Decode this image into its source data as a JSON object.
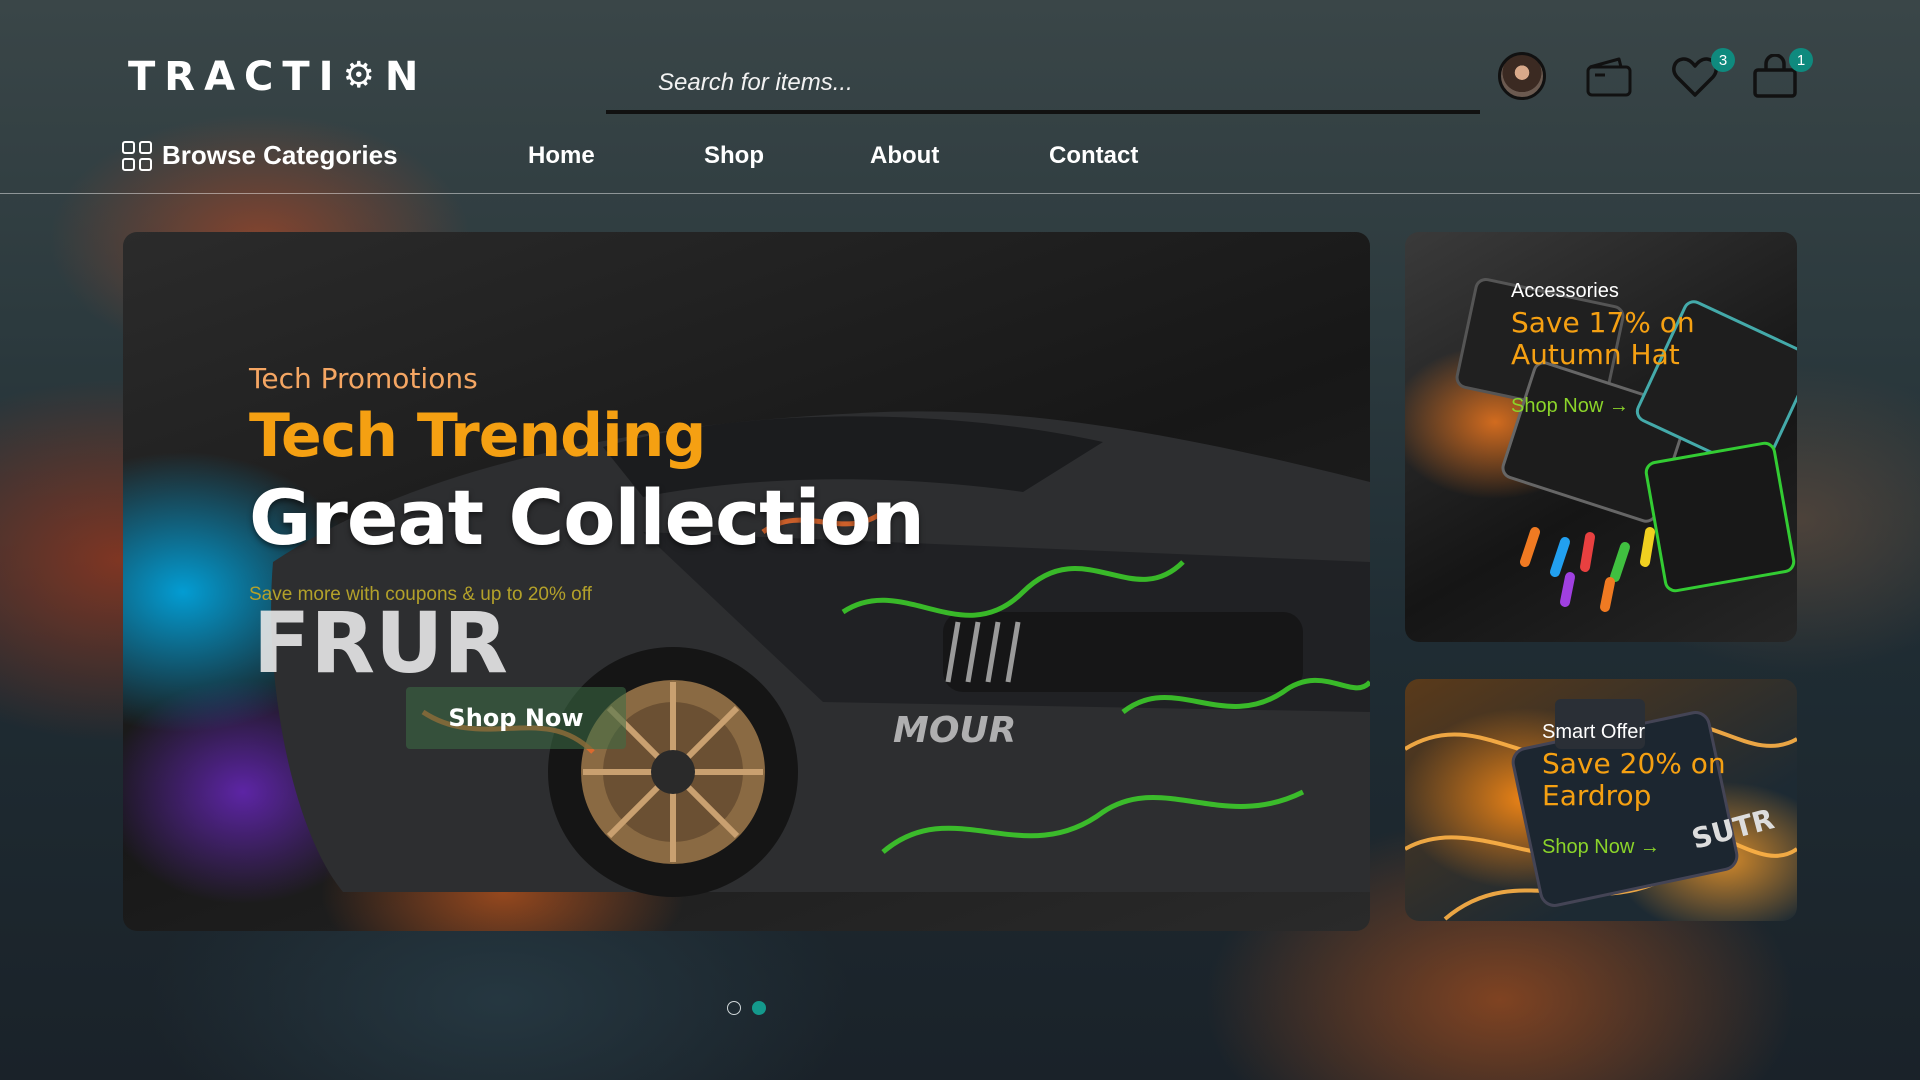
{
  "brand": {
    "logo_text_left": "TRACTI",
    "logo_text_right": "N"
  },
  "search": {
    "placeholder": "Search for items..."
  },
  "header_icons": {
    "avatar": "avatar",
    "wallet": "wallet-icon",
    "wishlist": {
      "icon": "heart-icon",
      "count": "3"
    },
    "cart": {
      "icon": "shopping-bag-icon",
      "count": "1"
    }
  },
  "nav": {
    "browse_categories": "Browse Categories",
    "links": [
      "Home",
      "Shop",
      "About",
      "Contact"
    ]
  },
  "hero": {
    "subtitle": "Tech Promotions",
    "title_line1": "Tech Trending",
    "title_line2": "Great Collection",
    "description": "Save more with coupons & up to 20% off",
    "button": "Shop Now"
  },
  "cards": [
    {
      "subtitle": "Accessories",
      "title": "Save 17% on Autumn Hat",
      "link": "Shop Now →"
    },
    {
      "subtitle": "Smart Offer",
      "title": "Save 20% on Eardrop",
      "link": "Shop Now →"
    }
  ],
  "carousel": {
    "slides": 2,
    "active": 2
  },
  "colors": {
    "accent_orange": "#f5a012",
    "accent_teal": "#14998c",
    "link_green": "#8bd42a"
  }
}
